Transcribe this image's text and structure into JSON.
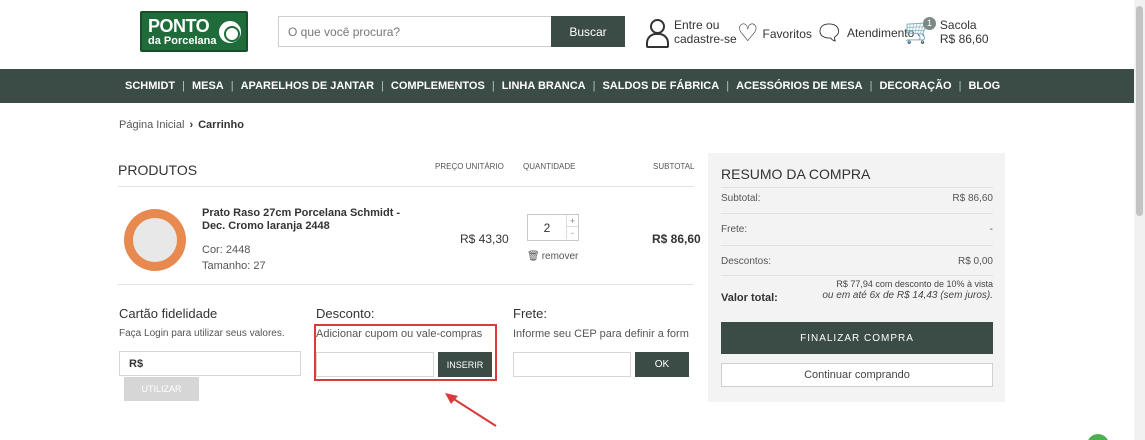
{
  "header": {
    "logo": {
      "line1": "PONTO",
      "line2": "da Porcelana"
    },
    "search": {
      "placeholder": "O que você procura?",
      "button": "Buscar"
    },
    "account": {
      "line1": "Entre ou",
      "line2": "cadastre-se"
    },
    "favorites": "Favoritos",
    "support": "Atendimento",
    "bag": {
      "label": "Sacola",
      "count": "1",
      "total": "R$ 86,60"
    }
  },
  "nav": [
    "SCHMIDT",
    "MESA",
    "APARELHOS DE JANTAR",
    "COMPLEMENTOS",
    "LINHA BRANCA",
    "SALDOS DE FÁBRICA",
    "ACESSÓRIOS DE MESA",
    "DECORAÇÃO",
    "BLOG"
  ],
  "breadcrumb": {
    "home": "Página Inicial",
    "current": "Carrinho"
  },
  "products": {
    "title": "PRODUTOS",
    "headers": {
      "unit_price": "PREÇO UNITÁRIO",
      "quantity": "QUANTIDADE",
      "subtotal": "SUBTOTAL"
    },
    "item": {
      "name": "Prato Raso 27cm Porcelana Schmidt - Dec. Cromo laranja 2448",
      "color": "Cor: 2448",
      "size": "Tamanho: 27",
      "unit_price": "R$ 43,30",
      "quantity": "2",
      "plus": "+",
      "minus": "-",
      "remove": "remover",
      "subtotal": "R$ 86,60"
    }
  },
  "loyalty": {
    "title": "Cartão fidelidade",
    "desc": "Faça Login para utilizar seus valores.",
    "prefix": "R$",
    "button": "UTILIZAR"
  },
  "discount": {
    "title": "Desconto:",
    "desc": "Adicionar cupom ou vale-compras",
    "button": "INSERIR"
  },
  "shipping": {
    "title": "Frete:",
    "desc": "Informe seu CEP para definir a forma de entrega",
    "button": "OK"
  },
  "summary": {
    "title": "RESUMO DA COMPRA",
    "subtotal_label": "Subtotal:",
    "subtotal_value": "R$ 86,60",
    "shipping_label": "Frete:",
    "shipping_value": "-",
    "discount_label": "Descontos:",
    "discount_value": "R$ 0,00",
    "total_label": "Valor total:",
    "total_line1": "R$ 77,94 com desconto de 10% à vista",
    "total_line2": "ou em até 6x de R$ 14,43 (sem juros).",
    "checkout_button": "FINALIZAR COMPRA",
    "continue_button": "Continuar comprando"
  },
  "colors": {
    "brand_green": "#3b4b45",
    "logo_green": "#1f6b3a",
    "highlight_red": "#d93a3a"
  }
}
